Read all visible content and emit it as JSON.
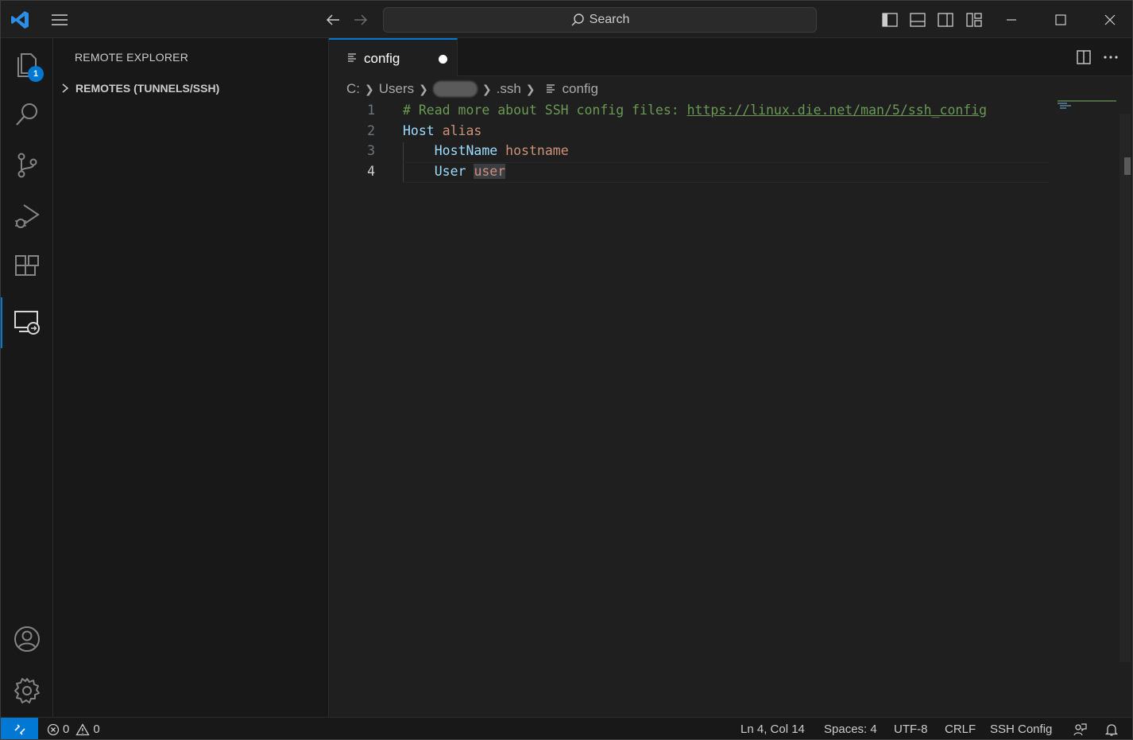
{
  "titlebar": {
    "search_label": "Search"
  },
  "activitybar": {
    "explorer_badge": "1"
  },
  "sidebar": {
    "title": "REMOTE EXPLORER",
    "section": "REMOTES (TUNNELS/SSH)"
  },
  "editor": {
    "tab_label": "config",
    "breadcrumb": {
      "drive": "C:",
      "users": "Users",
      "ssh": ".ssh",
      "file": "config"
    },
    "lines": [
      {
        "num": "1",
        "comment": "# Read more about SSH config files: ",
        "link": "https://linux.die.net/man/5/ssh_config"
      },
      {
        "num": "2",
        "key": "Host",
        "value": "alias"
      },
      {
        "num": "3",
        "key": "HostName",
        "value": "hostname"
      },
      {
        "num": "4",
        "key": "User",
        "value": "user"
      }
    ]
  },
  "statusbar": {
    "errors": "0",
    "warnings": "0",
    "position": "Ln 4, Col 14",
    "spaces": "Spaces: 4",
    "encoding": "UTF-8",
    "eol": "CRLF",
    "language": "SSH Config"
  },
  "colors": {
    "accent": "#0078d4",
    "comment": "#6a9955",
    "keyword": "#9cdcfe",
    "string": "#ce9178"
  }
}
